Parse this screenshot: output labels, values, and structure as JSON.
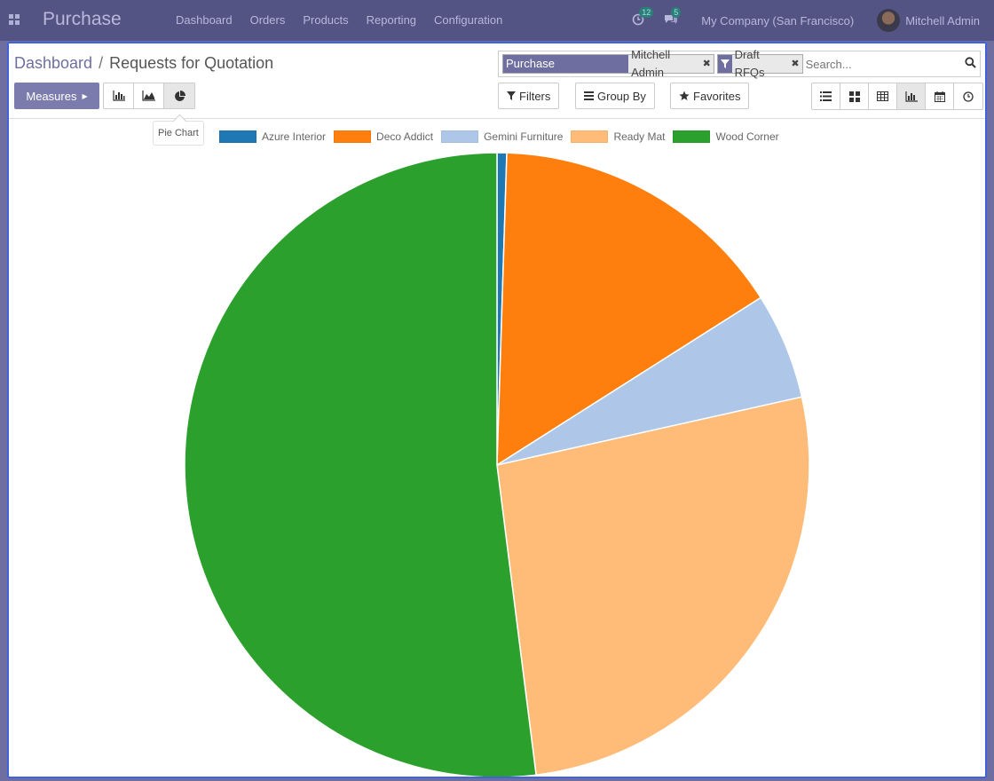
{
  "navbar": {
    "brand": "Purchase",
    "menu": [
      "Dashboard",
      "Orders",
      "Products",
      "Reporting",
      "Configuration"
    ],
    "activity_count": "12",
    "message_count": "5",
    "company": "My Company (San Francisco)",
    "user": "Mitchell Admin"
  },
  "breadcrumb": {
    "parent": "Dashboard",
    "separator": "/",
    "current": "Requests for Quotation"
  },
  "search": {
    "facet_representative_label": "Purchase Representative",
    "facet_representative_value": "Mitchell Admin",
    "facet_filter_value": "Draft RFQs",
    "placeholder": "Search..."
  },
  "buttons": {
    "measures": "Measures",
    "filters": "Filters",
    "group_by": "Group By",
    "favorites": "Favorites"
  },
  "tooltip": "Pie Chart",
  "colors": {
    "accent": "#7c7bad",
    "navbar": "#535384",
    "panel_border": "#3e63dd"
  },
  "chart_data": {
    "type": "pie",
    "labels": [
      "Azure Interior",
      "Deco Addict",
      "Gemini Furniture",
      "Ready Mat",
      "Wood Corner"
    ],
    "values": [
      0.5,
      15.5,
      5.5,
      26.5,
      52.0
    ],
    "colors": [
      "#1f77b4",
      "#ff7f0e",
      "#aec7e8",
      "#ffbb78",
      "#2ca02c"
    ],
    "legend": "top"
  }
}
